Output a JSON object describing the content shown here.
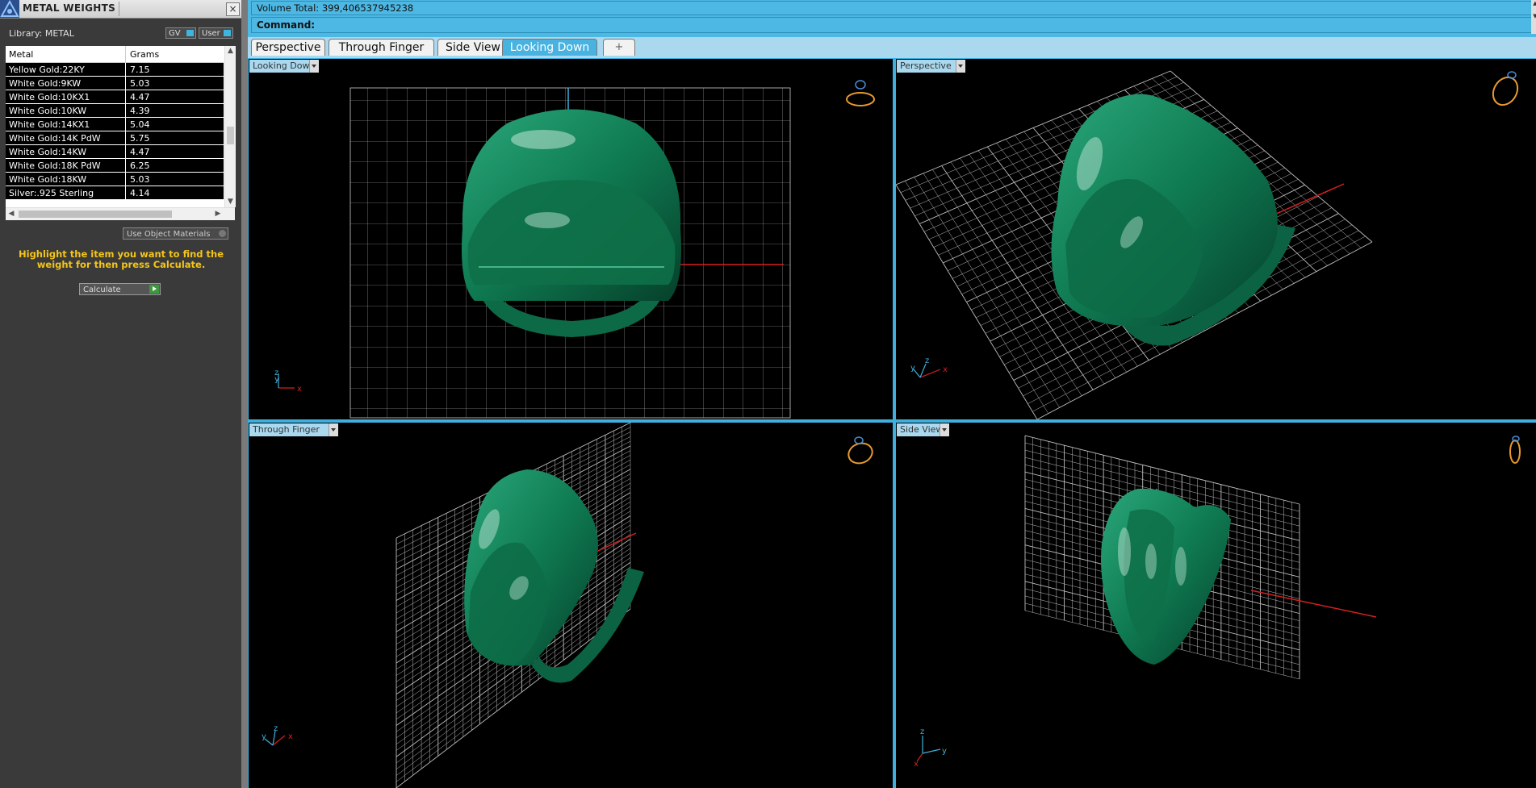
{
  "panel": {
    "title": "METAL WEIGHTS",
    "close": "×",
    "library_label": "Library: METAL",
    "gv_label": "GV",
    "user_label": "User",
    "columns": [
      "Metal",
      "Grams"
    ],
    "rows": [
      {
        "metal": "Yellow Gold:22KY",
        "grams": "7.15"
      },
      {
        "metal": "White Gold:9KW",
        "grams": "5.03"
      },
      {
        "metal": "White Gold:10KX1",
        "grams": "4.47"
      },
      {
        "metal": "White Gold:10KW",
        "grams": "4.39"
      },
      {
        "metal": "White Gold:14KX1",
        "grams": "5.04"
      },
      {
        "metal": "White Gold:14K PdW",
        "grams": "5.75"
      },
      {
        "metal": "White Gold:14KW",
        "grams": "4.47"
      },
      {
        "metal": "White Gold:18K PdW",
        "grams": "6.25"
      },
      {
        "metal": "White Gold:18KW",
        "grams": "5.03"
      },
      {
        "metal": "Silver:.925 Sterling",
        "grams": "4.14"
      }
    ],
    "use_object_materials": "Use Object Materials",
    "hint": "Highlight the item you want to find the weight for then press Calculate.",
    "calculate": "Calculate"
  },
  "command": {
    "volume": "Volume Total: 399,406537945238",
    "command_label": "Command:"
  },
  "tabs": [
    {
      "label": "Perspective",
      "active": false
    },
    {
      "label": "Through Finger",
      "active": false
    },
    {
      "label": "Side View",
      "active": false
    },
    {
      "label": "Looking Down",
      "active": true
    }
  ],
  "tab_add": "+",
  "viewports": {
    "top_left": {
      "label": "Looking Down",
      "axes": [
        "z",
        "y",
        "x"
      ]
    },
    "top_right": {
      "label": "Perspective",
      "axes": [
        "z",
        "y",
        "x"
      ]
    },
    "bottom_left": {
      "label": "Through Finger",
      "axes": [
        "z",
        "y",
        "x"
      ]
    },
    "bottom_right": {
      "label": "Side View",
      "axes": [
        "z",
        "y",
        "x"
      ]
    }
  },
  "colors": {
    "accent": "#48b2e0",
    "ring": "#0f7a52",
    "hint": "#f5c518",
    "grid": "#cfcfcf",
    "axis_x": "#d42020"
  },
  "icons": [
    "app-logo-icon",
    "close-icon",
    "gear-icon",
    "play-icon",
    "ring-preview-icon",
    "chevron-down-icon"
  ]
}
